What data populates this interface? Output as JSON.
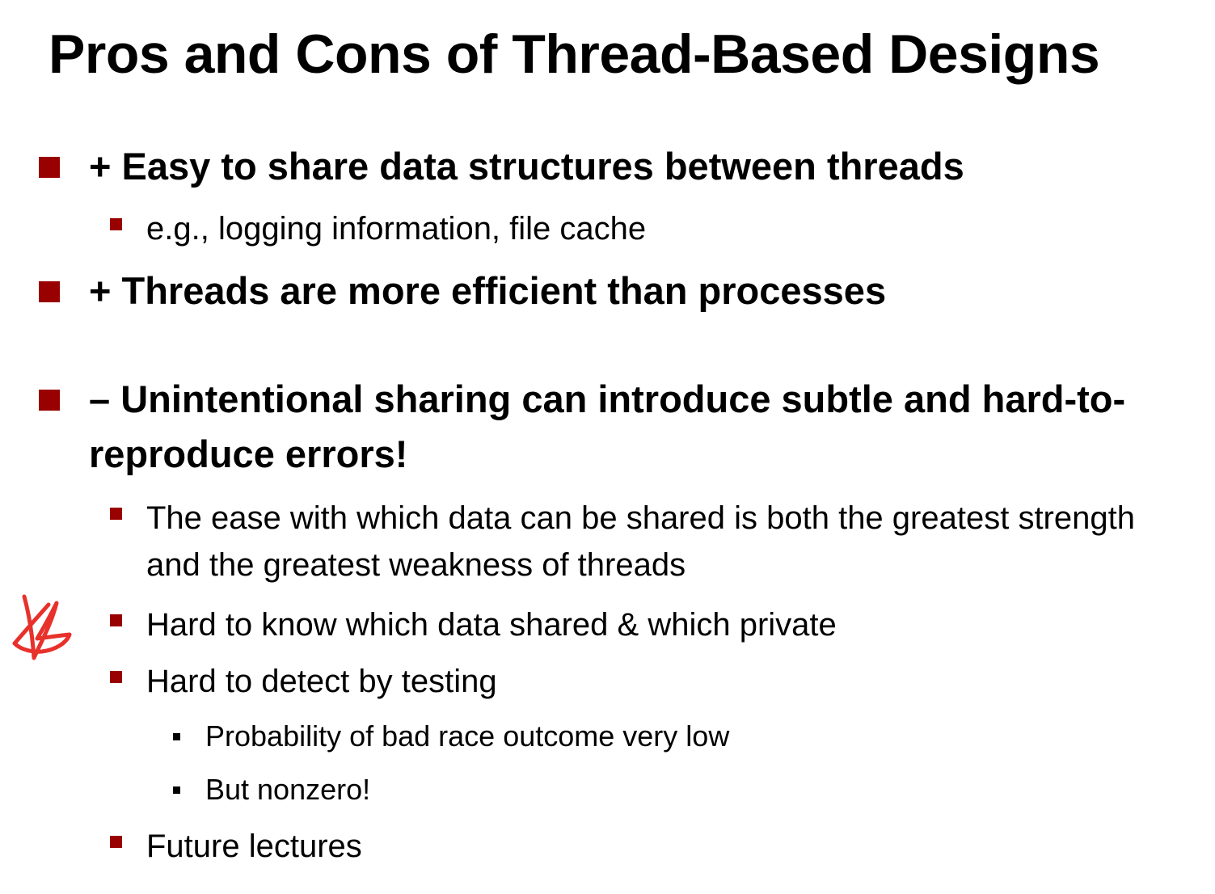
{
  "title": "Pros and Cons of Thread-Based Designs",
  "bullets": [
    {
      "text": "+ Easy to share data structures between threads",
      "sub": [
        {
          "text": "e.g., logging information, file cache"
        }
      ]
    },
    {
      "text": "+ Threads are more efficient than processes",
      "sub": []
    },
    {
      "text": "– Unintentional sharing can introduce subtle and hard-to-reproduce errors!",
      "sub": [
        {
          "text": "The ease with which data can be shared is both the greatest strength and the greatest weakness of threads"
        },
        {
          "text": "Hard to know which data shared & which private"
        },
        {
          "text": "Hard to detect by testing",
          "sub": [
            {
              "text": "Probability of bad race outcome very low"
            },
            {
              "text": "But nonzero!"
            }
          ]
        },
        {
          "text": "Future lectures"
        }
      ]
    }
  ],
  "colors": {
    "bullet_marker": "#990000",
    "annotation": "#e8312b",
    "text": "#000000"
  },
  "annotation_icon": "hand-drawn-star-icon"
}
